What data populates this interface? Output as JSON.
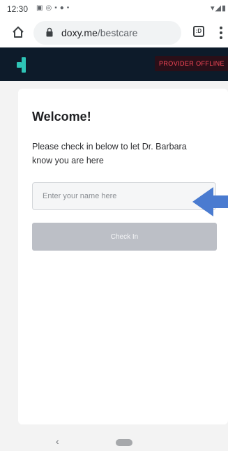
{
  "status_bar": {
    "time": "12:30",
    "icons": [
      "image-icon",
      "messenger-icon",
      "slack-icon",
      "chat-icon",
      "dot-icon"
    ],
    "right_icons": [
      "wifi-icon",
      "signal-icon",
      "battery-icon"
    ]
  },
  "browser": {
    "url_host": "doxy.me",
    "url_path": "/bestcare",
    "tab_count": ":D"
  },
  "header": {
    "status_badge": "PROVIDER OFFLINE",
    "badge_color": "#ff4a5a",
    "header_color": "#0d1b2a",
    "logo_color": "#2ec4b6"
  },
  "checkin": {
    "title": "Welcome!",
    "message": "Please check in below to let Dr. Barbara know you are here",
    "name_placeholder": "Enter your name here",
    "name_value": "",
    "button_label": "Check In"
  },
  "annotation": {
    "arrow_color": "#4a7bd0",
    "points_to": "name-input"
  },
  "nav": {
    "back_symbol": "‹"
  }
}
